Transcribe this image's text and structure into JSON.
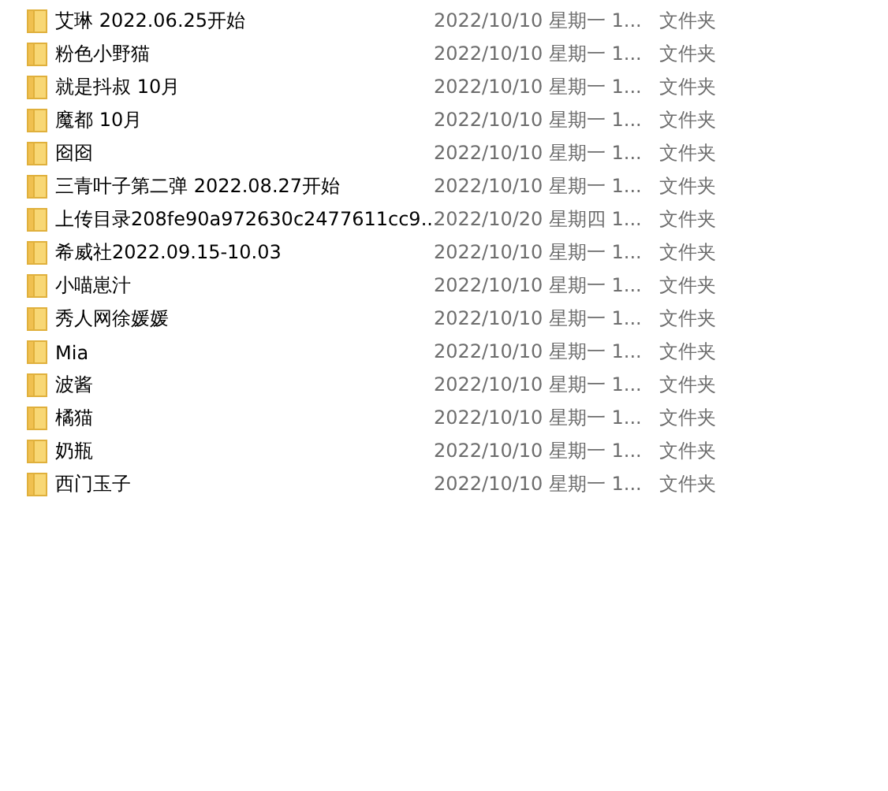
{
  "files": [
    {
      "name": "艾琳 2022.06.25开始",
      "modified": "2022/10/10 星期一 1...",
      "type": "文件夹"
    },
    {
      "name": "粉色小野猫",
      "modified": "2022/10/10 星期一 1...",
      "type": "文件夹"
    },
    {
      "name": "就是抖叔 10月",
      "modified": "2022/10/10 星期一 1...",
      "type": "文件夹"
    },
    {
      "name": "魔都 10月",
      "modified": "2022/10/10 星期一 1...",
      "type": "文件夹"
    },
    {
      "name": "囵囵",
      "modified": "2022/10/10 星期一 1...",
      "type": "文件夹"
    },
    {
      "name": "三青叶子第二弹 2022.08.27开始",
      "modified": "2022/10/10 星期一 1...",
      "type": "文件夹"
    },
    {
      "name": "上传目录208fe90a972630c2477611cc9...",
      "modified": "2022/10/20 星期四 1...",
      "type": "文件夹"
    },
    {
      "name": "希威社2022.09.15-10.03",
      "modified": "2022/10/10 星期一 1...",
      "type": "文件夹"
    },
    {
      "name": "小喵崽汁",
      "modified": "2022/10/10 星期一 1...",
      "type": "文件夹"
    },
    {
      "name": "秀人网徐媛媛",
      "modified": "2022/10/10 星期一 1...",
      "type": "文件夹"
    },
    {
      "name": "Mia",
      "modified": "2022/10/10 星期一 1...",
      "type": "文件夹"
    },
    {
      "name": "波酱",
      "modified": "2022/10/10 星期一 1...",
      "type": "文件夹"
    },
    {
      "name": "橘猫",
      "modified": "2022/10/10 星期一 1...",
      "type": "文件夹"
    },
    {
      "name": "奶瓶",
      "modified": "2022/10/10 星期一 1...",
      "type": "文件夹"
    },
    {
      "name": "西门玉子",
      "modified": "2022/10/10 星期一 1...",
      "type": "文件夹"
    }
  ]
}
